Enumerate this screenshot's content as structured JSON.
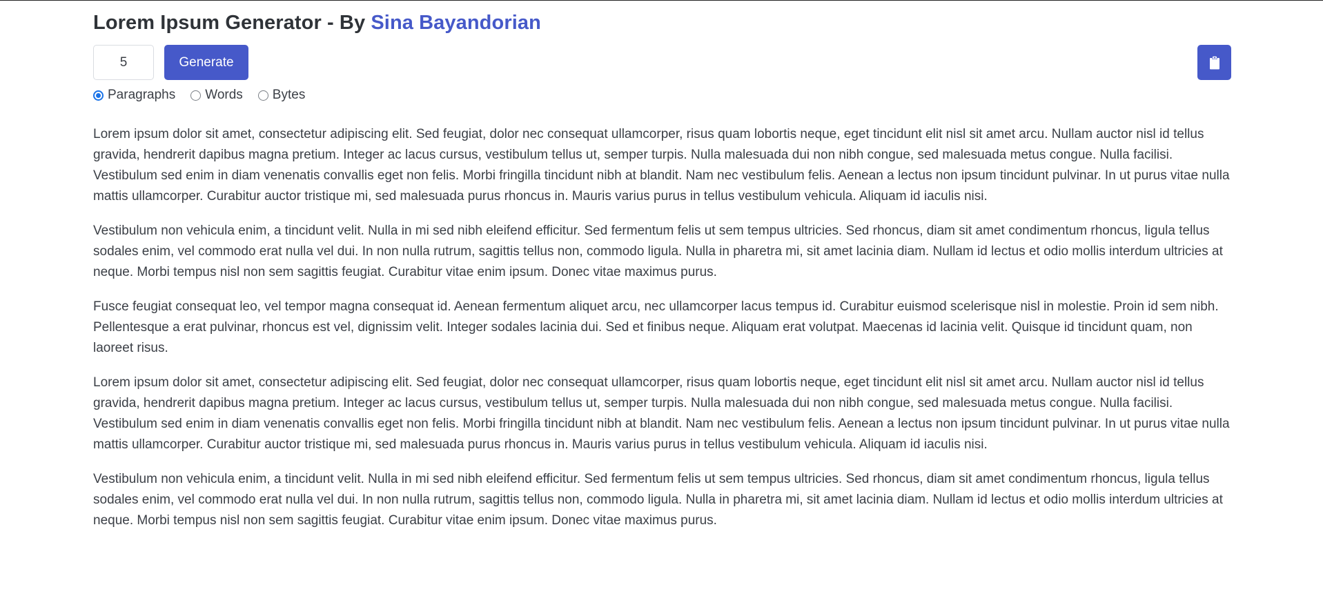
{
  "header": {
    "title_prefix": "Lorem Ipsum Generator - By ",
    "author": "Sina Bayandorian"
  },
  "controls": {
    "count_value": "5",
    "generate_label": "Generate",
    "copy_icon": "clipboard-icon"
  },
  "options": [
    {
      "label": "Paragraphs",
      "checked": true
    },
    {
      "label": "Words",
      "checked": false
    },
    {
      "label": "Bytes",
      "checked": false
    }
  ],
  "paragraphs": [
    "Lorem ipsum dolor sit amet, consectetur adipiscing elit. Sed feugiat, dolor nec consequat ullamcorper, risus quam lobortis neque, eget tincidunt elit nisl sit amet arcu. Nullam auctor nisl id tellus gravida, hendrerit dapibus magna pretium. Integer ac lacus cursus, vestibulum tellus ut, semper turpis. Nulla malesuada dui non nibh congue, sed malesuada metus congue. Nulla facilisi. Vestibulum sed enim in diam venenatis convallis eget non felis. Morbi fringilla tincidunt nibh at blandit. Nam nec vestibulum felis. Aenean a lectus non ipsum tincidunt pulvinar. In ut purus vitae nulla mattis ullamcorper. Curabitur auctor tristique mi, sed malesuada purus rhoncus in. Mauris varius purus in tellus vestibulum vehicula. Aliquam id iaculis nisi.",
    "Vestibulum non vehicula enim, a tincidunt velit. Nulla in mi sed nibh eleifend efficitur. Sed fermentum felis ut sem tempus ultricies. Sed rhoncus, diam sit amet condimentum rhoncus, ligula tellus sodales enim, vel commodo erat nulla vel dui. In non nulla rutrum, sagittis tellus non, commodo ligula. Nulla in pharetra mi, sit amet lacinia diam. Nullam id lectus et odio mollis interdum ultricies at neque. Morbi tempus nisl non sem sagittis feugiat. Curabitur vitae enim ipsum. Donec vitae maximus purus.",
    "Fusce feugiat consequat leo, vel tempor magna consequat id. Aenean fermentum aliquet arcu, nec ullamcorper lacus tempus id. Curabitur euismod scelerisque nisl in molestie. Proin id sem nibh. Pellentesque a erat pulvinar, rhoncus est vel, dignissim velit. Integer sodales lacinia dui. Sed et finibus neque. Aliquam erat volutpat. Maecenas id lacinia velit. Quisque id tincidunt quam, non laoreet risus.",
    "Lorem ipsum dolor sit amet, consectetur adipiscing elit. Sed feugiat, dolor nec consequat ullamcorper, risus quam lobortis neque, eget tincidunt elit nisl sit amet arcu. Nullam auctor nisl id tellus gravida, hendrerit dapibus magna pretium. Integer ac lacus cursus, vestibulum tellus ut, semper turpis. Nulla malesuada dui non nibh congue, sed malesuada metus congue. Nulla facilisi. Vestibulum sed enim in diam venenatis convallis eget non felis. Morbi fringilla tincidunt nibh at blandit. Nam nec vestibulum felis. Aenean a lectus non ipsum tincidunt pulvinar. In ut purus vitae nulla mattis ullamcorper. Curabitur auctor tristique mi, sed malesuada purus rhoncus in. Mauris varius purus in tellus vestibulum vehicula. Aliquam id iaculis nisi.",
    "Vestibulum non vehicula enim, a tincidunt velit. Nulla in mi sed nibh eleifend efficitur. Sed fermentum felis ut sem tempus ultricies. Sed rhoncus, diam sit amet condimentum rhoncus, ligula tellus sodales enim, vel commodo erat nulla vel dui. In non nulla rutrum, sagittis tellus non, commodo ligula. Nulla in pharetra mi, sit amet lacinia diam. Nullam id lectus et odio mollis interdum ultricies at neque. Morbi tempus nisl non sem sagittis feugiat. Curabitur vitae enim ipsum. Donec vitae maximus purus."
  ],
  "colors": {
    "accent": "#4659c9",
    "radio_checked": "#1a73e8",
    "text": "#3b3f46"
  }
}
